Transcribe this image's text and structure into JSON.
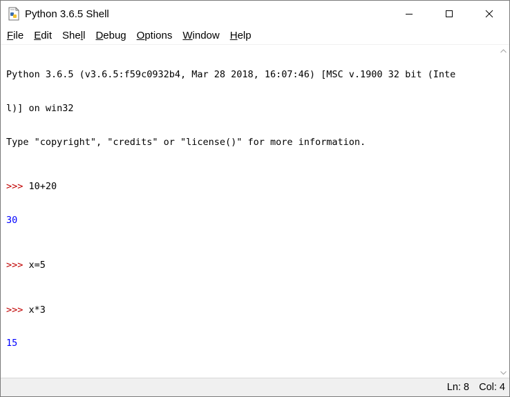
{
  "window": {
    "title": "Python 3.6.5 Shell",
    "icon": "python-idle-icon",
    "controls": [
      "minimize-icon",
      "maximize-icon",
      "close-icon"
    ]
  },
  "menu": [
    {
      "label": "File",
      "key_letter": "F",
      "rest": "ile"
    },
    {
      "label": "Edit",
      "key_letter": "E",
      "rest": "dit"
    },
    {
      "label": "Shell",
      "pre": "She",
      "key_letter": "l",
      "rest": "l"
    },
    {
      "label": "Debug",
      "key_letter": "D",
      "rest": "ebug"
    },
    {
      "label": "Options",
      "key_letter": "O",
      "rest": "ptions"
    },
    {
      "label": "Window",
      "key_letter": "W",
      "rest": "indow"
    },
    {
      "label": "Help",
      "key_letter": "H",
      "rest": "elp"
    }
  ],
  "shell": {
    "banner_line1": "Python 3.6.5 (v3.6.5:f59c0932b4, Mar 28 2018, 16:07:46) [MSC v.1900 32 bit (Inte",
    "banner_line2": "l)] on win32",
    "banner_line3": "Type \"copyright\", \"credits\" or \"license()\" for more information.",
    "prompt": ">>>",
    "entries": [
      {
        "input": "10+20",
        "output": "30"
      },
      {
        "input": "x=5"
      },
      {
        "input": "x*3",
        "output": "15"
      }
    ],
    "current_input": ""
  },
  "statusbar": {
    "ln": "Ln: 8",
    "col": "Col: 4"
  },
  "colors": {
    "prompt": "#c00000",
    "output": "#0000ff",
    "text": "#000000"
  }
}
